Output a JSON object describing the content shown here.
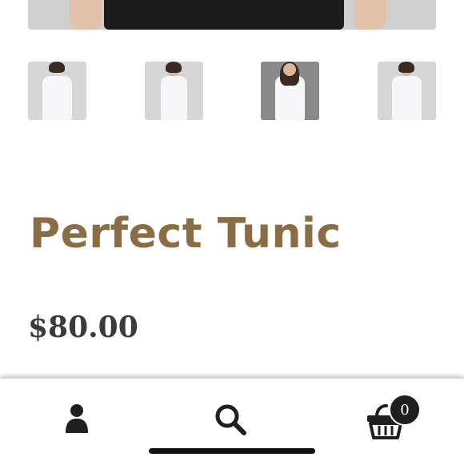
{
  "product": {
    "title": "Perfect Tunic",
    "price": "$80.00"
  },
  "thumbnails": [
    {
      "view": "back"
    },
    {
      "view": "side"
    },
    {
      "view": "front"
    },
    {
      "view": "side-front"
    }
  ],
  "bottom_nav": {
    "account_icon": "user-icon",
    "search_icon": "search-icon",
    "cart_icon": "basket-icon",
    "cart_count": "0"
  },
  "colors": {
    "title": "#8b6d45",
    "price": "#3b3b3b",
    "icons": "#1f1f1f"
  }
}
